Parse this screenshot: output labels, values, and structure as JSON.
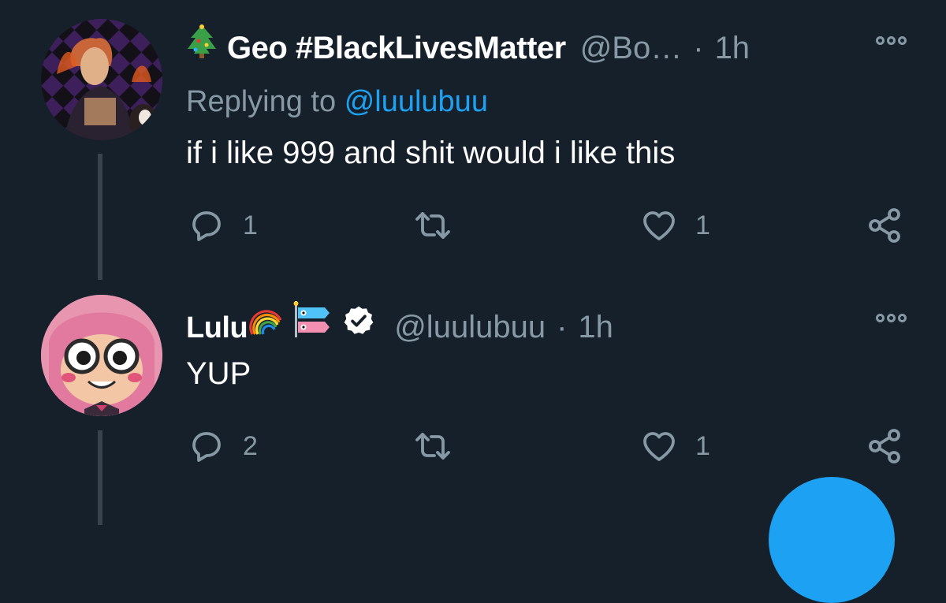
{
  "tweets": [
    {
      "emoji_prefix": "christmas-tree",
      "name": "Geo #BlackLivesMatter",
      "handle": "@Bo…",
      "separator": "·",
      "time": "1h",
      "replying_prefix": "Replying to",
      "replying_mention": "@luulubuu",
      "text": "if i like 999 and shit would i like this",
      "replies": "1",
      "retweets": "",
      "likes": "1"
    },
    {
      "name": "Lulu",
      "name_emojis": [
        "rainbow",
        "carp-streamer"
      ],
      "verified": true,
      "handle": "@luulubuu",
      "separator": "·",
      "time": "1h",
      "text": "YUP",
      "replies": "2",
      "retweets": "",
      "likes": "1"
    }
  ],
  "colors": {
    "background": "#15202b",
    "text_primary": "#ffffff",
    "text_secondary": "#8899a6",
    "accent": "#1da1f2",
    "thread_line": "#38444d"
  },
  "icons": [
    "reply-icon",
    "retweet-icon",
    "like-icon",
    "share-icon",
    "more-icon",
    "verified-badge-icon"
  ]
}
